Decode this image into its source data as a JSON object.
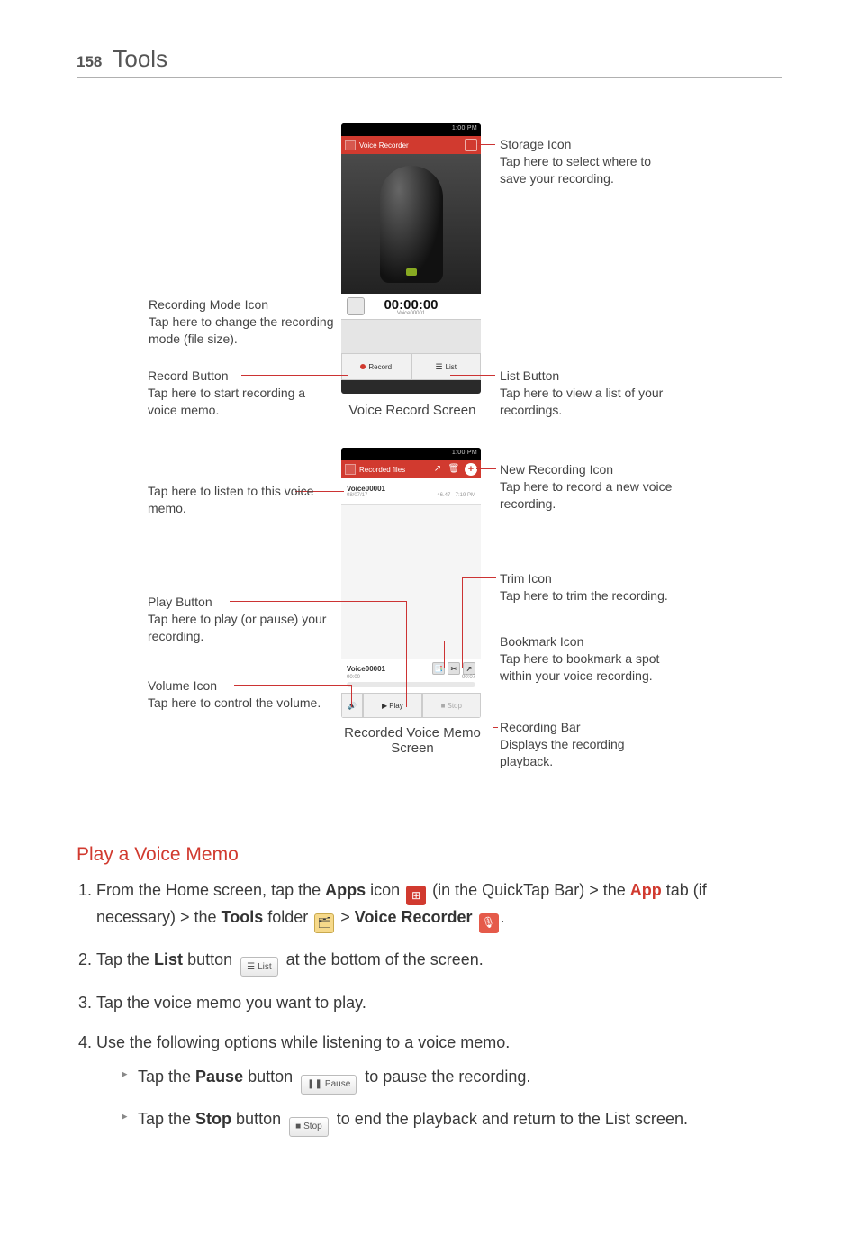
{
  "page": {
    "number": "158",
    "title": "Tools"
  },
  "phone_common": {
    "status_time": "1:00 PM"
  },
  "phone1": {
    "titlebar": "Voice Recorder",
    "timer": "00:00:00",
    "filename": "Voice00001",
    "btn_record": "Record",
    "btn_list": "List",
    "caption": "Voice Record Screen"
  },
  "phone2": {
    "titlebar": "Recorded files",
    "file": {
      "name": "Voice00001",
      "date": "08/07/17",
      "size": "46.47",
      "duration": "7:19 PM"
    },
    "player": {
      "name": "Voice00001",
      "cur": "00:00",
      "end": "00:07"
    },
    "btn_play": "Play",
    "btn_stop": "Stop",
    "caption": "Recorded Voice Memo Screen"
  },
  "callouts": {
    "storage": {
      "title": "Storage Icon",
      "desc": "Tap here to select where to save your recording."
    },
    "mode": {
      "title": "Recording Mode Icon",
      "desc": "Tap here to change the recording mode (file size)."
    },
    "record": {
      "title": "Record Button",
      "desc": "Tap here to start recording a voice memo."
    },
    "list": {
      "title": "List Button",
      "desc": "Tap here to view a list of your recordings."
    },
    "listen": {
      "title": "",
      "desc": "Tap here to listen to this voice memo."
    },
    "newrec": {
      "title": "New Recording Icon",
      "desc": "Tap here to record a new voice recording."
    },
    "play": {
      "title": "Play Button",
      "desc": "Tap here to play (or pause) your recording."
    },
    "volume": {
      "title": "Volume Icon",
      "desc": "Tap here to control the volume."
    },
    "trim": {
      "title": "Trim Icon",
      "desc": "Tap here to trim the recording."
    },
    "bookmark": {
      "title": "Bookmark Icon",
      "desc": "Tap here to bookmark a spot within your voice recording."
    },
    "recbar": {
      "title": "Recording Bar",
      "desc": "Displays the recording playback."
    }
  },
  "section": {
    "heading": "Play a Voice Memo",
    "steps": {
      "s1a": "From the Home screen, tap the ",
      "s1_apps": "Apps",
      "s1b": " icon ",
      "s1c": " (in the QuickTap Bar) > the ",
      "s1_app": "App",
      "s1d": " tab (if necessary) > the ",
      "s1_tools": "Tools",
      "s1e": " folder ",
      "s1f": " > ",
      "s1_vr": "Voice Recorder",
      "s1g": ".",
      "s2a": "Tap the ",
      "s2_list": "List",
      "s2b": " button ",
      "s2c": " at the bottom of the screen.",
      "s3": "Tap the voice memo you want to play.",
      "s4": "Use the following options while listening to a voice memo.",
      "sub1a": "Tap the ",
      "sub1_pause": "Pause",
      "sub1b": " button ",
      "sub1c": " to pause the recording.",
      "sub2a": "Tap the ",
      "sub2_stop": "Stop",
      "sub2b": " button ",
      "sub2c": " to end the playback and return to the List screen."
    },
    "inline_btns": {
      "list": "List",
      "pause": "Pause",
      "stop": "Stop"
    }
  }
}
